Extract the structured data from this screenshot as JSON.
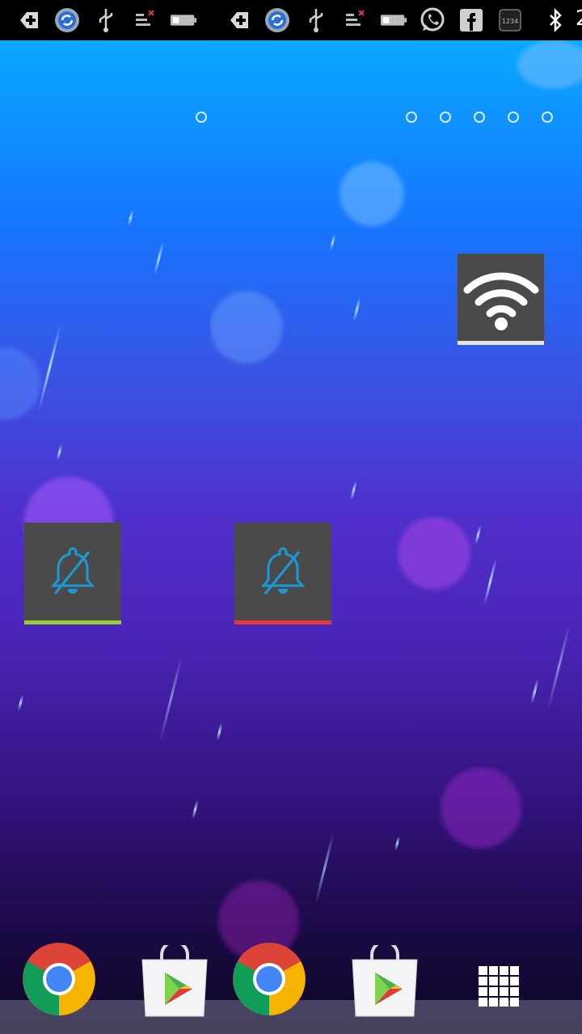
{
  "status_bar": {
    "icons": [
      "add-icon",
      "sync-icon",
      "usb-icon",
      "signal-off-icon",
      "battery-icon",
      "add-icon",
      "sync-icon",
      "usb-icon",
      "signal-off-icon",
      "battery-icon",
      "whatsapp-icon",
      "facebook-icon",
      "keyboard-icon",
      "bluetooth-icon"
    ],
    "clock_fragment": "2"
  },
  "left_screen": {
    "page_indicator_count": 1,
    "silent_toggle": {
      "icon": "bell-off-icon",
      "indicator_color": "#9acd32"
    }
  },
  "right_screen": {
    "page_indicator_count": 5,
    "wifi_toggle": {
      "icon": "wifi-icon",
      "indicator_color": "#e6e6e6"
    },
    "silent_toggle": {
      "icon": "bell-off-icon",
      "indicator_color": "#e53935"
    }
  },
  "dock": {
    "apps": [
      "chrome-icon",
      "play-store-icon",
      "chrome-icon",
      "play-store-icon",
      "app-drawer-icon"
    ]
  },
  "colors": {
    "accent_blue": "#1a9ad6",
    "tile_bg": "#4a4a4a"
  }
}
